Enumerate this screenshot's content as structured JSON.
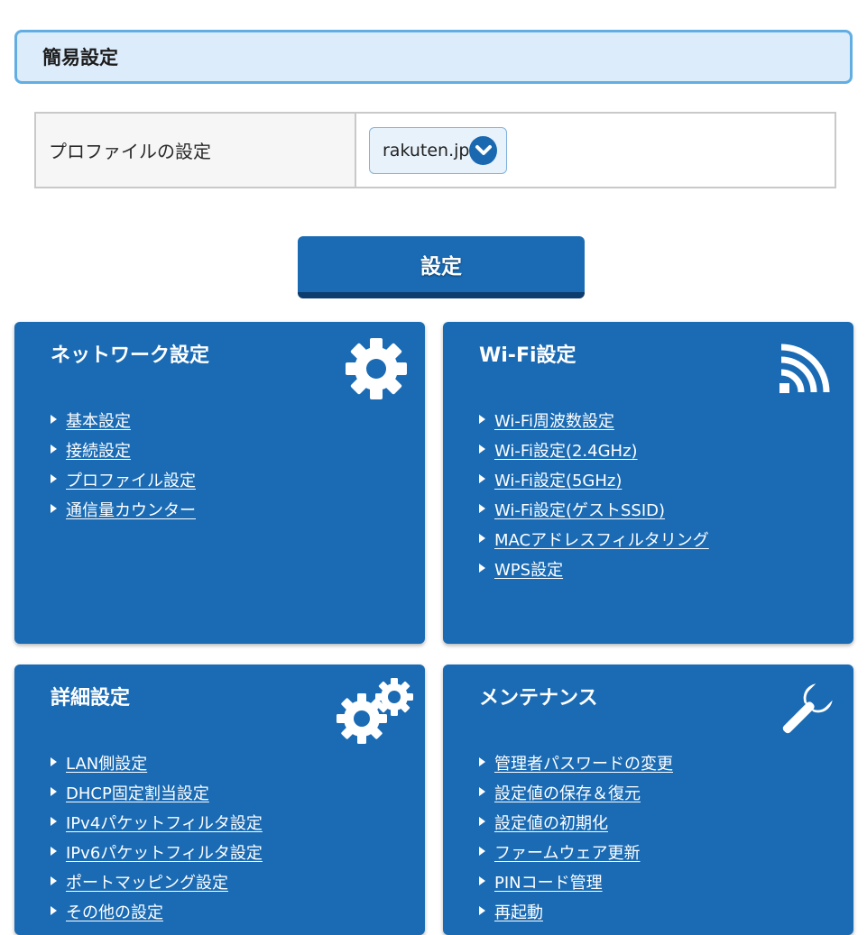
{
  "section": {
    "title": "簡易設定"
  },
  "profile": {
    "label": "プロファイルの設定",
    "selected": "rakuten.jp"
  },
  "apply_button": "設定",
  "cards": {
    "network": {
      "title": "ネットワーク設定",
      "icon": "gear-icon",
      "links": [
        "基本設定",
        "接続設定",
        "プロファイル設定",
        "通信量カウンター"
      ]
    },
    "wifi": {
      "title": "Wi-Fi設定",
      "icon": "wifi-signal-icon",
      "links": [
        "Wi-Fi周波数設定",
        "Wi-Fi設定(2.4GHz)",
        "Wi-Fi設定(5GHz)",
        "Wi-Fi設定(ゲストSSID)",
        "MACアドレスフィルタリング",
        "WPS設定"
      ]
    },
    "advanced": {
      "title": "詳細設定",
      "icon": "gears-icon",
      "links": [
        "LAN側設定",
        "DHCP固定割当設定",
        "IPv4パケットフィルタ設定",
        "IPv6パケットフィルタ設定",
        "ポートマッピング設定",
        "その他の設定"
      ]
    },
    "maintenance": {
      "title": "メンテナンス",
      "icon": "wrench-icon",
      "links": [
        "管理者パスワードの変更",
        "設定値の保存＆復元",
        "設定値の初期化",
        "ファームウェア更新",
        "PINコード管理",
        "再起動"
      ]
    }
  },
  "colors": {
    "card_blue": "#1a6bb4",
    "header_bg": "#dcecfb",
    "header_border": "#62aee3"
  }
}
